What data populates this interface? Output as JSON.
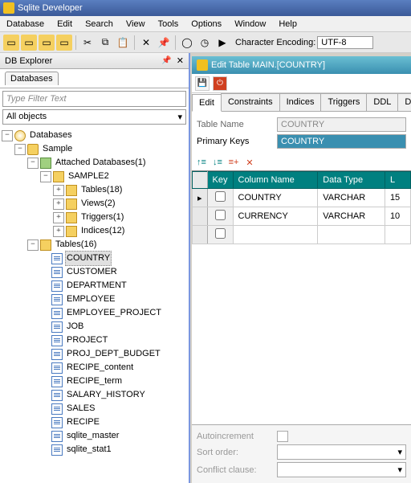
{
  "title": "Sqlite Developer",
  "menu": [
    "Database",
    "Edit",
    "Search",
    "View",
    "Tools",
    "Options",
    "Window",
    "Help"
  ],
  "encoding": {
    "label": "Character Encoding:",
    "value": "UTF-8"
  },
  "explorer": {
    "title": "DB Explorer",
    "tab": "Databases",
    "filter_placeholder": "Type Filter Text",
    "all_objects": "All objects",
    "root": "Databases",
    "sample": "Sample",
    "attached": "Attached Databases(1)",
    "sample2": "SAMPLE2",
    "sample2_children": [
      {
        "label": "Tables(18)"
      },
      {
        "label": "Views(2)"
      },
      {
        "label": "Triggers(1)"
      },
      {
        "label": "Indices(12)"
      }
    ],
    "tables_label": "Tables(16)",
    "tables": [
      "COUNTRY",
      "CUSTOMER",
      "DEPARTMENT",
      "EMPLOYEE",
      "EMPLOYEE_PROJECT",
      "JOB",
      "PROJECT",
      "PROJ_DEPT_BUDGET",
      "RECIPE_content",
      "RECIPE_term",
      "SALARY_HISTORY",
      "SALES",
      "RECIPE",
      "sqlite_master",
      "sqlite_stat1"
    ]
  },
  "editor": {
    "title": "Edit Table MAIN.[COUNTRY]",
    "tabs": [
      "Edit",
      "Constraints",
      "Indices",
      "Triggers",
      "DDL",
      "Data"
    ],
    "table_name_label": "Table Name",
    "table_name_value": "COUNTRY",
    "pk_label": "Primary Keys",
    "pk_value": "COUNTRY",
    "grid": {
      "headers": [
        "Key",
        "Column Name",
        "Data Type",
        "L"
      ],
      "rows": [
        {
          "key": false,
          "name": "COUNTRY",
          "type": "VARCHAR",
          "len": "15"
        },
        {
          "key": false,
          "name": "CURRENCY",
          "type": "VARCHAR",
          "len": "10"
        }
      ]
    },
    "bottom": {
      "autoincrement": "Autoincrement",
      "sort": "Sort order:",
      "conflict": "Conflict clause:"
    }
  }
}
